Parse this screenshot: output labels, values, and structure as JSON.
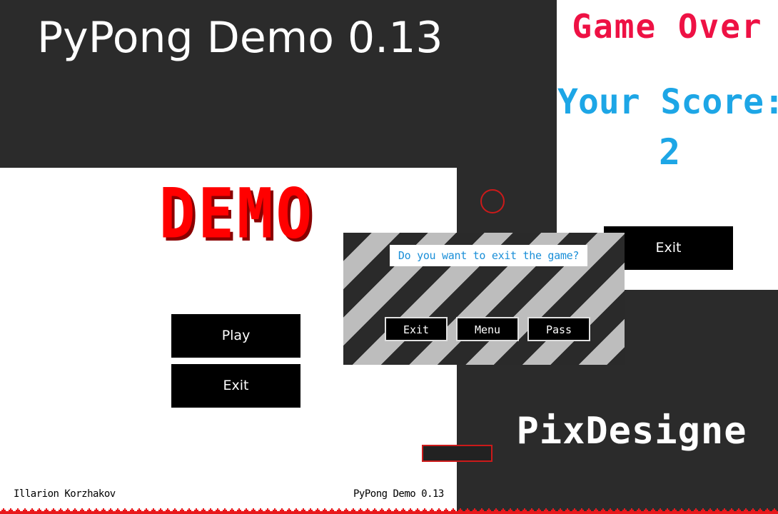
{
  "window": {
    "title": "PyPong Demo 0.13"
  },
  "menu": {
    "logo": "DEMO",
    "play_label": "Play",
    "exit_label": "Exit",
    "author": "Illarion Korzhakov",
    "version": "PyPong Demo 0.13"
  },
  "game_over": {
    "title": "Game Over",
    "score_label": "Your Score:",
    "score_value": "2",
    "exit_label": "Exit"
  },
  "dialog": {
    "question": "Do you want to exit the game?",
    "exit_label": "Exit",
    "menu_label": "Menu",
    "pass_label": "Pass"
  },
  "studio": {
    "name": "PixDesigne"
  },
  "colors": {
    "background": "#2b2b2b",
    "logo_red": "#ff0000",
    "game_over_pink": "#ee1144",
    "score_blue": "#1da6e6",
    "button_black": "#000000"
  }
}
